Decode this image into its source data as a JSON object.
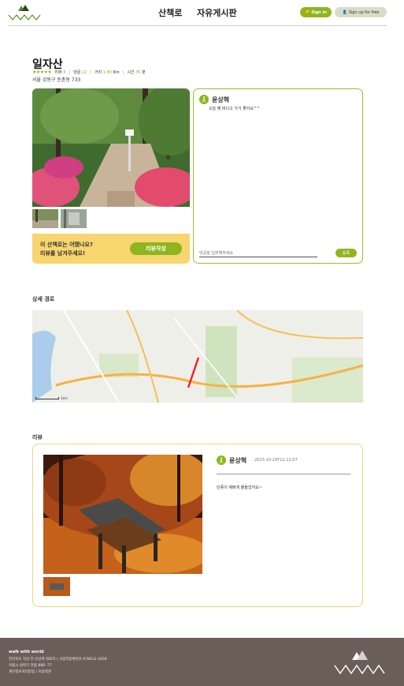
{
  "header": {
    "nav": [
      "산책로",
      "자유게시판"
    ],
    "signin_label": "Sign in",
    "signup_label": "Sign up for free"
  },
  "trail": {
    "title": "일자산",
    "rating_stars": "★★★★★",
    "review_label": "리뷰",
    "review_count": "8",
    "comment_label": "댓글",
    "comment_count": "22",
    "distance_label": "거리",
    "distance_value": "1.80",
    "distance_unit": "Km",
    "time_label": "시간",
    "time_value": "35",
    "time_unit": "분",
    "address": "서울 강동구 둔촌동 733"
  },
  "cta": {
    "line1": "이 산책로는 어땠나요?",
    "line2": "리뷰를 남겨주세요!",
    "button": "리뷰작성"
  },
  "comments": {
    "user": "윤상혁",
    "text": "오늘 해 떠다고 가기 좋아요^^",
    "input_placeholder": "댓글을 입력해주세요",
    "submit": "등록"
  },
  "route": {
    "section_title": "상세 경로",
    "scale_label": "1km"
  },
  "review": {
    "section_title": "리뷰",
    "user": "윤상혁",
    "date": "2023-10-24T12:12:07",
    "text": "단풍이 예쁘게 물들었어요~"
  },
  "footer": {
    "brand": "walk with world",
    "line1": "전라북도 익산 전 유상혁 대표자 | 사업자등록번호 678612-3458",
    "line2": "서울시 송파구 관광 888 -77",
    "line3": "개인정보처리방침 | 이용약관"
  },
  "colors": {
    "accent_green": "#8fb51e",
    "cta_yellow": "#f7d56f",
    "footer_brown": "#6b5d57",
    "logo_green": "#5b8a2e"
  },
  "icons": {
    "logo": "mountain-wave-logo",
    "signin": "key-icon",
    "signup": "user-plus-icon",
    "avatar": "walker-icon"
  }
}
